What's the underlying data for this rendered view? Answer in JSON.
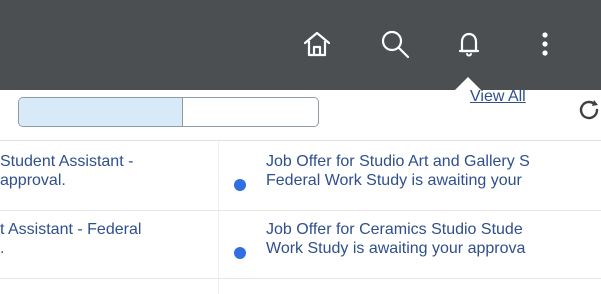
{
  "header": {
    "icons": {
      "home": "home-icon",
      "search": "search-icon",
      "notifications": "bell-icon",
      "more": "more-vertical-icon"
    }
  },
  "toolbar": {
    "tabs": [
      {
        "label": ""
      },
      {
        "label": ""
      }
    ],
    "view_all": "View All",
    "refresh_icon": "refresh-icon"
  },
  "notifications": {
    "left_items": [
      {
        "text": "Student Assistant -\napproval."
      },
      {
        "text": "t Assistant - Federal\n."
      }
    ],
    "right_items": [
      {
        "text": "Job Offer for Studio Art and Gallery S\nFederal Work Study is awaiting your"
      },
      {
        "text": "Job Offer for Ceramics Studio Stude\nWork Study is awaiting your approva"
      }
    ]
  },
  "colors": {
    "header_bg": "#4b4f52",
    "link": "#2f4f8d",
    "tab_bg": "#d8eaf8",
    "dot": "#2f6fe1"
  }
}
